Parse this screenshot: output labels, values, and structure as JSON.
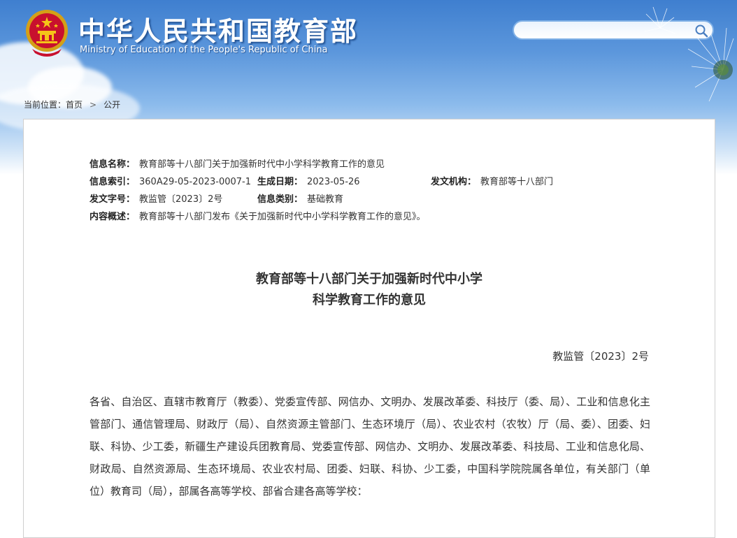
{
  "header": {
    "title": "中华人民共和国教育部",
    "subtitle": "Ministry of Education of the People's Republic of China",
    "search": {
      "placeholder": ""
    }
  },
  "breadcrumb": {
    "prefix": "当前位置：",
    "items": [
      "首页",
      "公开"
    ],
    "separator": ">"
  },
  "info": {
    "name_label": "信息名称：",
    "name_value": "教育部等十八部门关于加强新时代中小学科学教育工作的意见",
    "index_label": "信息索引：",
    "index_value": "360A29-05-2023-0007-1",
    "date_label": "生成日期：",
    "date_value": "2023-05-26",
    "org_label": "发文机构：",
    "org_value": "教育部等十八部门",
    "docno_label": "发文字号：",
    "docno_value": "教监管〔2023〕2号",
    "type_label": "信息类别：",
    "type_value": "基础教育",
    "summary_label": "内容概述：",
    "summary_value": "教育部等十八部门发布《关于加强新时代中小学科学教育工作的意见》。"
  },
  "document": {
    "title_line1": "教育部等十八部门关于加强新时代中小学",
    "title_line2": "科学教育工作的意见",
    "number": "教监管〔2023〕2号",
    "body": "各省、自治区、直辖市教育厅（教委）、党委宣传部、网信办、文明办、发展改革委、科技厅（委、局）、工业和信息化主管部门、通信管理局、财政厅（局）、自然资源主管部门、生态环境厅（局）、农业农村（农牧）厅（局、委）、团委、妇联、科协、少工委，新疆生产建设兵团教育局、党委宣传部、网信办、文明办、发展改革委、科技局、工业和信息化局、财政局、自然资源局、生态环境局、农业农村局、团委、妇联、科协、少工委，中国科学院院属各单位，有关部门（单位）教育司（局），部属各高等学校、部省合建各高等学校："
  },
  "colors": {
    "header_blue": "#3f7fcf",
    "text": "#333333",
    "border": "#cfcfcf"
  },
  "icons": {
    "emblem": "national-emblem-icon",
    "search": "search-icon"
  }
}
